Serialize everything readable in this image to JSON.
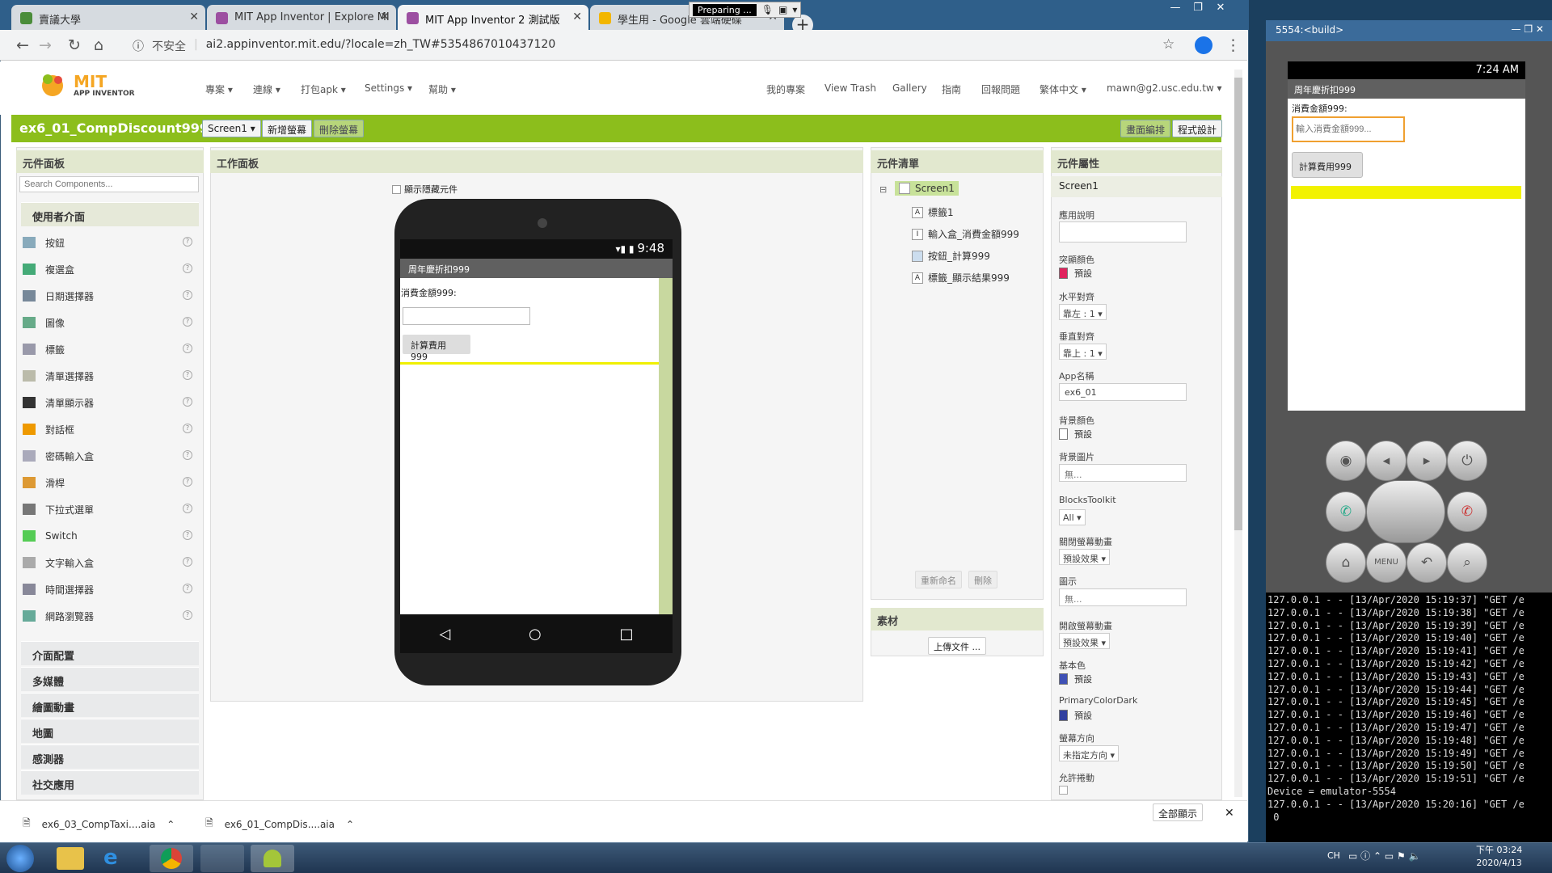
{
  "browser": {
    "tabs": [
      {
        "title": "賣議大學",
        "favicon_color": "#4a8d3a"
      },
      {
        "title": "MIT App Inventor | Explore MI",
        "favicon_color": "#9c4fa1"
      },
      {
        "title": "MIT App Inventor 2 測試版",
        "favicon_color": "#9c4fa1"
      },
      {
        "title": "學生用 - Google 雲端硬碟",
        "favicon_color": "#f2b600"
      }
    ],
    "preparing": "Preparing ...",
    "insecure_label": "不安全",
    "url": "ai2.appinventor.mit.edu/?locale=zh_TW#5354867010437120",
    "new_tab": "+"
  },
  "app": {
    "logo_mit": "MIT",
    "logo_sub": "APP INVENTOR",
    "menu_left": [
      "專案 ▾",
      "連線 ▾",
      "打包apk ▾",
      "Settings ▾",
      "幫助 ▾"
    ],
    "menu_right": [
      "我的專案",
      "View Trash",
      "Gallery",
      "指南",
      "回報問題",
      "繁体中文 ▾",
      "mawn@g2.usc.edu.tw ▾"
    ],
    "project_name": "ex6_01_CompDiscount999",
    "screen_select": "Screen1 ▾",
    "add_screen": "新增螢幕",
    "remove_screen": "刪除螢幕",
    "designer": "畫面編排",
    "blocks": "程式設計"
  },
  "palette": {
    "title": "元件面板",
    "search_placeholder": "Search Components...",
    "ui_category": "使用者介面",
    "items": [
      "按鈕",
      "複選盒",
      "日期選擇器",
      "圖像",
      "標籤",
      "清單選擇器",
      "清單顯示器",
      "對話框",
      "密碼輸入盒",
      "滑桿",
      "下拉式選單",
      "Switch",
      "文字輸入盒",
      "時間選擇器",
      "網路瀏覽器"
    ],
    "categories": [
      "介面配置",
      "多媒體",
      "繪圖動畫",
      "地圖",
      "感測器",
      "社交應用"
    ]
  },
  "viewer": {
    "title": "工作面板",
    "hidden_checkbox": "顯示隱藏元件",
    "status_time": "9:48",
    "screen_title": "周年慶折扣999",
    "label_text": "消費金額999:",
    "button_text": "計算費用999"
  },
  "components": {
    "title": "元件清單",
    "root": "Screen1",
    "items": [
      "標籤1",
      "輸入盒_消費金額999",
      "按鈕_計算999",
      "標籤_顯示結果999"
    ],
    "rename": "重新命名",
    "delete": "刪除",
    "media_title": "素材",
    "upload": "上傳文件 ..."
  },
  "properties": {
    "title": "元件屬性",
    "component": "Screen1",
    "about_label": "應用說明",
    "accent_label": "突顯顏色",
    "accent_value": "預設",
    "accent_color": "#e0245e",
    "halign_label": "水平對齊",
    "halign_value": "靠左 : 1 ▾",
    "valign_label": "垂直對齊",
    "valign_value": "靠上 : 1 ▾",
    "appname_label": "App名稱",
    "appname_value": "ex6_01",
    "bgcolor_label": "背景顏色",
    "bgcolor_value": "預設",
    "bgimage_label": "背景圖片",
    "bgimage_value": "無...",
    "toolkit_label": "BlocksToolkit",
    "toolkit_value": "All ▾",
    "closeanim_label": "關閉螢幕動畫",
    "closeanim_value": "預設效果 ▾",
    "icon_label": "圖示",
    "icon_value": "無...",
    "openanim_label": "開啟螢幕動畫",
    "openanim_value": "預設效果 ▾",
    "primary_label": "基本色",
    "primary_value": "預設",
    "primary_color": "#3f51b5",
    "primarydark_label": "PrimaryColorDark",
    "primarydark_value": "預設",
    "primarydark_color": "#303f9f",
    "orientation_label": "螢幕方向",
    "orientation_value": "未指定方向 ▾",
    "scroll_label": "允許捲動"
  },
  "downloads": {
    "files": [
      "ex6_03_CompTaxi....aia",
      "ex6_01_CompDis....aia"
    ],
    "show_all": "全部顯示"
  },
  "emulator": {
    "title": "5554:<build>",
    "time": "7:24 AM",
    "screen_title": "周年慶折扣999",
    "label_text": "消費金額999:",
    "input_placeholder": "輸入消費金額999...",
    "button_text": "計算費用999",
    "menu_label": "MENU"
  },
  "terminal": {
    "lines": [
      "127.0.0.1 - - [13/Apr/2020 15:19:37] \"GET /e",
      "127.0.0.1 - - [13/Apr/2020 15:19:38] \"GET /e",
      "127.0.0.1 - - [13/Apr/2020 15:19:39] \"GET /e",
      "127.0.0.1 - - [13/Apr/2020 15:19:40] \"GET /e",
      "127.0.0.1 - - [13/Apr/2020 15:19:41] \"GET /e",
      "127.0.0.1 - - [13/Apr/2020 15:19:42] \"GET /e",
      "127.0.0.1 - - [13/Apr/2020 15:19:43] \"GET /e",
      "127.0.0.1 - - [13/Apr/2020 15:19:44] \"GET /e",
      "127.0.0.1 - - [13/Apr/2020 15:19:45] \"GET /e",
      "127.0.0.1 - - [13/Apr/2020 15:19:46] \"GET /e",
      "127.0.0.1 - - [13/Apr/2020 15:19:47] \"GET /e",
      "127.0.0.1 - - [13/Apr/2020 15:19:48] \"GET /e",
      "127.0.0.1 - - [13/Apr/2020 15:19:49] \"GET /e",
      "127.0.0.1 - - [13/Apr/2020 15:19:50] \"GET /e",
      "127.0.0.1 - - [13/Apr/2020 15:19:51] \"GET /e",
      "Device = emulator-5554",
      "127.0.0.1 - - [13/Apr/2020 15:20:16] \"GET /e",
      " 0"
    ]
  },
  "taskbar": {
    "lang": "CH",
    "time": "下午 03:24",
    "date": "2020/4/13"
  }
}
